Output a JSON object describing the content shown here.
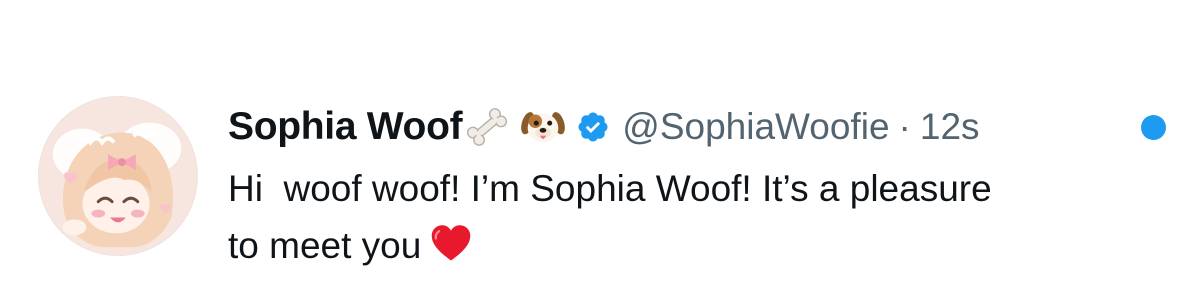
{
  "tweet": {
    "author": {
      "display_name": "Sophia Woof",
      "handle": "@SophiaWoofie",
      "verified": true,
      "name_emojis": [
        "bone-emoji",
        "dog-face-emoji"
      ],
      "avatar": "anime-dog-girl-avatar"
    },
    "separator": "·",
    "timestamp": "12s",
    "unread": true,
    "text_line_1": "Hi  woof woof! I’m Sophia Woof! It’s a pleasure",
    "text_line_2": "to meet you",
    "text_emoji": "red-heart-emoji"
  },
  "colors": {
    "text_primary": "#0f1419",
    "text_secondary": "#536471",
    "accent": "#1d9bf0"
  }
}
